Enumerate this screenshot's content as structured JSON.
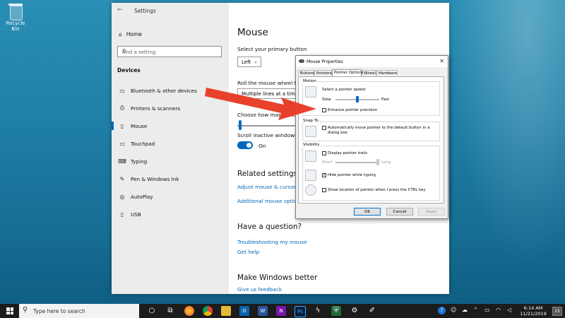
{
  "desktop": {
    "recycle_bin_label": "Recycle Bin"
  },
  "settings": {
    "window_title": "Settings",
    "home_label": "Home",
    "search_placeholder": "Find a setting",
    "section_heading": "Devices",
    "nav_items": [
      {
        "label": "Bluetooth & other devices",
        "icon": "bluetooth-icon"
      },
      {
        "label": "Printers & scanners",
        "icon": "printer-icon"
      },
      {
        "label": "Mouse",
        "icon": "mouse-icon",
        "selected": true
      },
      {
        "label": "Touchpad",
        "icon": "touchpad-icon"
      },
      {
        "label": "Typing",
        "icon": "keyboard-icon"
      },
      {
        "label": "Pen & Windows Ink",
        "icon": "pen-icon"
      },
      {
        "label": "AutoPlay",
        "icon": "autoplay-icon"
      },
      {
        "label": "USB",
        "icon": "usb-icon"
      }
    ],
    "main": {
      "title": "Mouse",
      "primary_button_label": "Select your primary button",
      "primary_button_value": "Left",
      "wheel_label": "Roll the mouse wheel to",
      "wheel_value": "Multiple lines at a time",
      "lines_label": "Choose how many lines",
      "scroll_inactive_label": "Scroll inactive windows w",
      "toggle_state": "On",
      "related_heading": "Related settings",
      "related_links": [
        "Adjust mouse & cursor s",
        "Additional mouse option"
      ],
      "question_heading": "Have a question?",
      "question_links": [
        "Troubleshooting my mouse",
        "Get help"
      ],
      "better_heading": "Make Windows better",
      "feedback_link": "Give us feedback"
    }
  },
  "mouse_properties": {
    "title": "Mouse Properties",
    "tabs": [
      "Buttons",
      "Pointers",
      "Pointer Options",
      "Wheel",
      "Hardware"
    ],
    "active_tab": "Pointer Options",
    "motion": {
      "group_label": "Motion",
      "speed_label": "Select a pointer speed:",
      "slow_label": "Slow",
      "fast_label": "Fast",
      "speed_level": 0.5,
      "enhance_label": "Enhance pointer precision",
      "enhance_checked": false
    },
    "snap_to": {
      "group_label": "Snap To",
      "label": "Automatically move pointer to the default button in a dialog box",
      "checked": false
    },
    "visibility": {
      "group_label": "Visibility",
      "trails_label": "Display pointer trails",
      "trails_checked": false,
      "short_label": "Short",
      "long_label": "Long",
      "trail_level": 1.0,
      "hide_label": "Hide pointer while typing",
      "hide_checked": true,
      "show_location_label": "Show location of pointer when I press the CTRL key",
      "show_location_checked": false
    },
    "buttons": {
      "ok": "OK",
      "cancel": "Cancel",
      "apply": "Apply"
    }
  },
  "taskbar": {
    "search_placeholder": "Type here to search",
    "time": "6:14 AM",
    "date": "11/21/2019",
    "notification_count": "15"
  },
  "colors": {
    "accent": "#0067c0",
    "arrow": "#e8412b"
  }
}
